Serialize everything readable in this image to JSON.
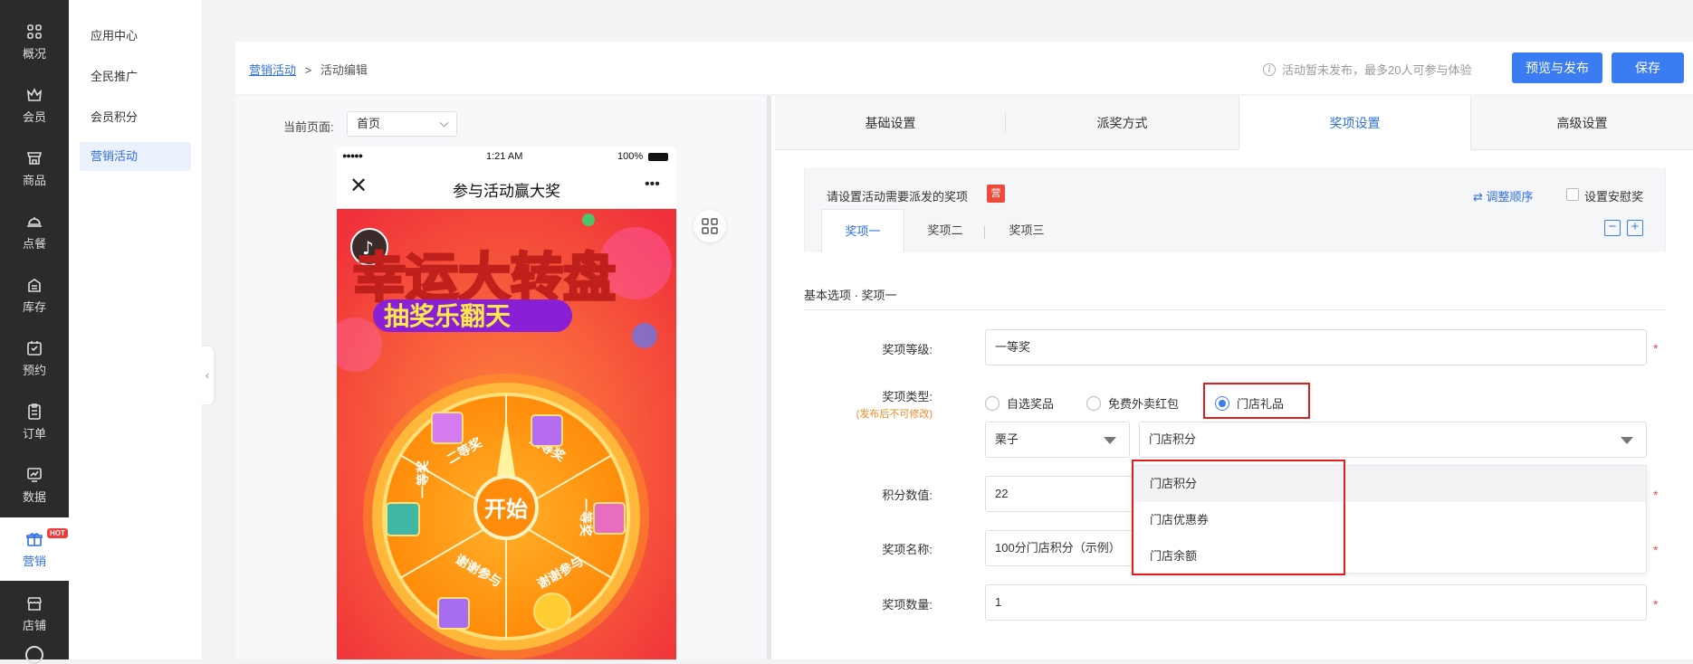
{
  "rail": {
    "items": [
      {
        "label": "概况",
        "icon": "grid-icon"
      },
      {
        "label": "会员",
        "icon": "crown-icon"
      },
      {
        "label": "商品",
        "icon": "shop-icon"
      },
      {
        "label": "点餐",
        "icon": "cloche-icon"
      },
      {
        "label": "库存",
        "icon": "inventory-icon"
      },
      {
        "label": "预约",
        "icon": "calendar-check-icon"
      },
      {
        "label": "订单",
        "icon": "clipboard-icon"
      },
      {
        "label": "数据",
        "icon": "chart-icon"
      },
      {
        "label": "营销",
        "icon": "gift-icon",
        "badge": "HOT"
      },
      {
        "label": "店铺",
        "icon": "store-icon"
      }
    ]
  },
  "subnav": {
    "items": [
      "应用中心",
      "全民推广",
      "会员积分",
      "营销活动"
    ],
    "active": "营销活动"
  },
  "breadcrumb": {
    "link": "营销活动",
    "separator": ">",
    "current": "活动编辑"
  },
  "topbar": {
    "notice": "活动暂未发布，最多20人可参与体验",
    "preview_publish": "预览与发布",
    "save": "保存"
  },
  "preview": {
    "page_label": "当前页面:",
    "page_value": "首页",
    "phone": {
      "signal": "●●●●●",
      "time": "1:21 AM",
      "battery": "100%",
      "close_icon": "close-icon",
      "title": "参与活动赢大奖",
      "more": "•••",
      "banner_title": "幸运大转盘",
      "banner_subtitle": "抽奖乐翻天",
      "start": "开始",
      "segments": [
        "二等奖",
        "三等奖",
        "一等奖",
        "谢谢参与",
        "谢谢参与",
        "一等奖"
      ]
    }
  },
  "tabs": [
    "基础设置",
    "派奖方式",
    "奖项设置",
    "高级设置"
  ],
  "active_tab": "奖项设置",
  "prize_panel": {
    "title": "请设置活动需要派发的奖项",
    "badge": "营",
    "reorder": "调整顺序",
    "consolation": "设置安慰奖",
    "tabs": [
      "奖项一",
      "奖项二",
      "奖项三"
    ],
    "minus": "−",
    "plus": "+"
  },
  "section_title": "基本选项 · 奖项一",
  "form": {
    "level_label": "奖项等级:",
    "level_value": "一等奖",
    "type_label": "奖项类型:",
    "type_note": "(发布后不可修改)",
    "type_options": [
      "自选奖品",
      "免费外卖红包",
      "门店礼品"
    ],
    "type_selected": "门店礼品",
    "store_select": "栗子",
    "gift_select": "门店积分",
    "points_label": "积分数值:",
    "points_value": "22",
    "name_label": "奖项名称:",
    "name_value": "100分门店积分（示例）",
    "qty_label": "奖项数量:",
    "qty_value": "1",
    "required_mark": "*"
  },
  "dropdown": {
    "options": [
      "门店积分",
      "门店优惠券",
      "门店余额"
    ],
    "highlighted": "门店积分"
  },
  "colors": {
    "accent": "#3b7cf2",
    "highlight_box": "#e31c1c",
    "rail": "#2b2b2b"
  }
}
